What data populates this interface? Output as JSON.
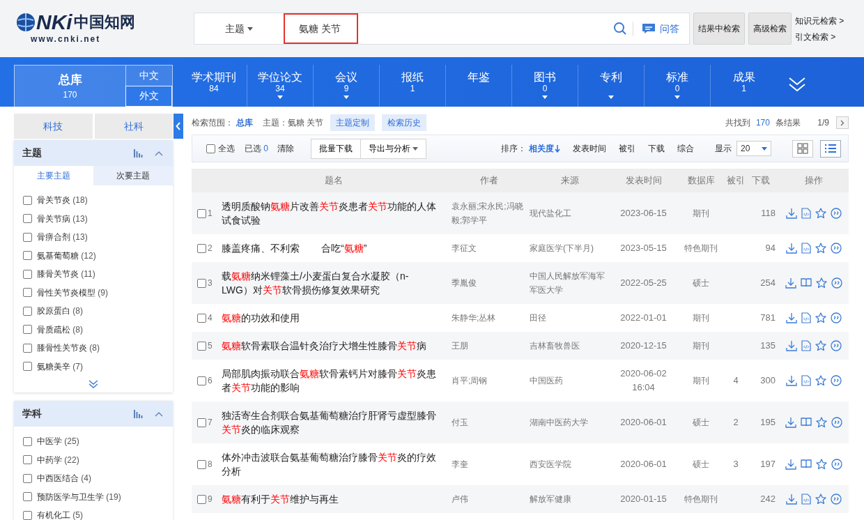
{
  "header": {
    "logo": {
      "mark": "NKi",
      "name": "中国知网",
      "url": "www.cnki.net"
    },
    "search": {
      "field": "主题",
      "value": "氨糖 关节",
      "qa": "问答"
    },
    "buttons": [
      "结果中检索",
      "高级检索"
    ],
    "links": [
      "知识元检索 >",
      "引文检索 >"
    ]
  },
  "nav": {
    "main": {
      "label": "总库",
      "count": "170",
      "selected": true
    },
    "langs": [
      {
        "label": "中文",
        "selected": false
      },
      {
        "label": "外文",
        "selected": true
      }
    ],
    "tabs": [
      {
        "label": "学术期刊",
        "count": "84",
        "expandable": false
      },
      {
        "label": "学位论文",
        "count": "34",
        "expandable": true
      },
      {
        "label": "会议",
        "count": "9",
        "expandable": true
      },
      {
        "label": "报纸",
        "count": "1",
        "expandable": false
      },
      {
        "label": "年鉴",
        "expandable": false
      },
      {
        "label": "图书",
        "count": "0",
        "expandable": true
      },
      {
        "label": "专利",
        "expandable": true
      },
      {
        "label": "标准",
        "count": "0",
        "expandable": true
      },
      {
        "label": "成果",
        "count": "1",
        "expandable": false
      }
    ]
  },
  "sidebar": {
    "categories": [
      {
        "label": "科技"
      },
      {
        "label": "社科"
      }
    ],
    "groups": [
      {
        "title": "主题",
        "has_more": true,
        "subtabs": [
          {
            "label": "主要主题",
            "selected": true
          },
          {
            "label": "次要主题",
            "selected": false
          }
        ],
        "items": [
          {
            "label": "骨关节炎",
            "count": "(18)",
            "checked": false
          },
          {
            "label": "骨关节病",
            "count": "(13)",
            "checked": false
          },
          {
            "label": "骨痹合剂",
            "count": "(13)",
            "checked": false
          },
          {
            "label": "氨基葡萄糖",
            "count": "(12)",
            "checked": false
          },
          {
            "label": "膝骨关节炎",
            "count": "(11)",
            "checked": false
          },
          {
            "label": "骨性关节炎模型",
            "count": "(9)",
            "checked": false
          },
          {
            "label": "胶原蛋白",
            "count": "(8)",
            "checked": false
          },
          {
            "label": "骨质疏松",
            "count": "(8)",
            "checked": false
          },
          {
            "label": "膝骨性关节炎",
            "count": "(8)",
            "checked": false
          },
          {
            "label": "氨糖美辛",
            "count": "(7)",
            "checked": false
          }
        ]
      },
      {
        "title": "学科",
        "has_more": false,
        "items": [
          {
            "label": "中医学",
            "count": "(25)",
            "checked": false
          },
          {
            "label": "中药学",
            "count": "(22)",
            "checked": false
          },
          {
            "label": "中西医结合",
            "count": "(4)",
            "checked": false
          },
          {
            "label": "预防医学与卫生学",
            "count": "(19)",
            "checked": false
          },
          {
            "label": "有机化工",
            "count": "(5)",
            "checked": false
          }
        ]
      }
    ]
  },
  "summary": {
    "scope_label": "检索范围：",
    "scope": "总库",
    "query": "主题：氨糖 关节",
    "buttons": [
      "主题定制",
      "检索历史"
    ],
    "found": "共找到",
    "total": "170",
    "unit": "条结果",
    "page": "1/9"
  },
  "toolbar": {
    "select_all": {
      "label": "全选",
      "checked": false
    },
    "selected_label": "已选",
    "selected_count": "0",
    "clear": "清除",
    "buttons": [
      "批量下载",
      "导出与分析"
    ],
    "sort_label": "排序：",
    "sorts": [
      {
        "label": "相关度",
        "selected": true
      },
      {
        "label": "发表时间",
        "selected": false
      },
      {
        "label": "被引",
        "selected": false
      },
      {
        "label": "下载",
        "selected": false
      },
      {
        "label": "综合",
        "selected": false
      }
    ],
    "show_label": "显示",
    "page_size": "20",
    "views": [
      {
        "kind": "grid",
        "selected": false
      },
      {
        "kind": "list",
        "selected": true
      }
    ]
  },
  "table": {
    "columns": [
      "题名",
      "作者",
      "来源",
      "发表时间",
      "数据库",
      "被引",
      "下载",
      "操作"
    ],
    "rows": [
      {
        "number": "1",
        "title": "透明质酸钠**氨糖**片改善**关节**炎患者**关节**功能的人体试食试验",
        "author": "袁永丽;宋永民;冯晓毅;郭学平",
        "source": "现代盐化工",
        "date": "2023-06-15",
        "database": "期刊",
        "cited": "",
        "downloads": "118",
        "kind": "html",
        "checked": false
      },
      {
        "number": "2",
        "title": "膝盖疼痛、不利索        合吃“**氨糖**”",
        "author": "李征文",
        "source": "家庭医学(下半月)",
        "date": "2023-05-15",
        "database": "特色期刊",
        "cited": "",
        "downloads": "94",
        "kind": "html",
        "checked": false
      },
      {
        "number": "3",
        "title": "载**氨糖**纳米锂藻土/小麦蛋白复合水凝胶（n-LWG）对**关节**软骨损伤修复效果研究",
        "author": "季胤俊",
        "source": "中国人民解放军海军军医大学",
        "date": "2022-05-25",
        "database": "硕士",
        "cited": "",
        "downloads": "254",
        "kind": "book",
        "checked": false
      },
      {
        "number": "4",
        "title": "**氨糖**的功效和使用",
        "author": "朱静华;丛林",
        "source": "田径",
        "date": "2022-01-01",
        "database": "期刊",
        "cited": "",
        "downloads": "781",
        "kind": "html",
        "checked": false
      },
      {
        "number": "5",
        "title": "**氨糖**软骨素联合温针灸治疗犬增生性膝骨**关节**病",
        "author": "王朋",
        "source": "吉林畜牧兽医",
        "date": "2020-12-15",
        "database": "期刊",
        "cited": "",
        "downloads": "135",
        "kind": "html",
        "checked": false
      },
      {
        "number": "6",
        "title": "局部肌肉振动联合**氨糖**软骨素钙片对膝骨**关节**炎患者**关节**功能的影响",
        "author": "肖平;周钢",
        "source": "中国医药",
        "date": "2020-06-02 16:04",
        "database": "期刊",
        "cited": "4",
        "downloads": "300",
        "kind": "html",
        "checked": false
      },
      {
        "number": "7",
        "title": "独活寄生合剂联合氨基葡萄糖治疗肝肾亏虚型膝骨**关节**炎的临床观察",
        "author": "付玉",
        "source": "湖南中医药大学",
        "date": "2020-06-01",
        "database": "硕士",
        "cited": "2",
        "downloads": "195",
        "kind": "book",
        "checked": false
      },
      {
        "number": "8",
        "title": "体外冲击波联合氨基葡萄糖治疗膝骨**关节**炎的疗效分析",
        "author": "李奎",
        "source": "西安医学院",
        "date": "2020-06-01",
        "database": "硕士",
        "cited": "3",
        "downloads": "197",
        "kind": "book",
        "checked": false
      },
      {
        "number": "9",
        "title": "**氨糖**有利于**关节**维护与再生",
        "author": "卢伟",
        "source": "解放军健康",
        "date": "2020-01-15",
        "database": "特色期刊",
        "cited": "",
        "downloads": "242",
        "kind": "html",
        "checked": false
      }
    ]
  }
}
